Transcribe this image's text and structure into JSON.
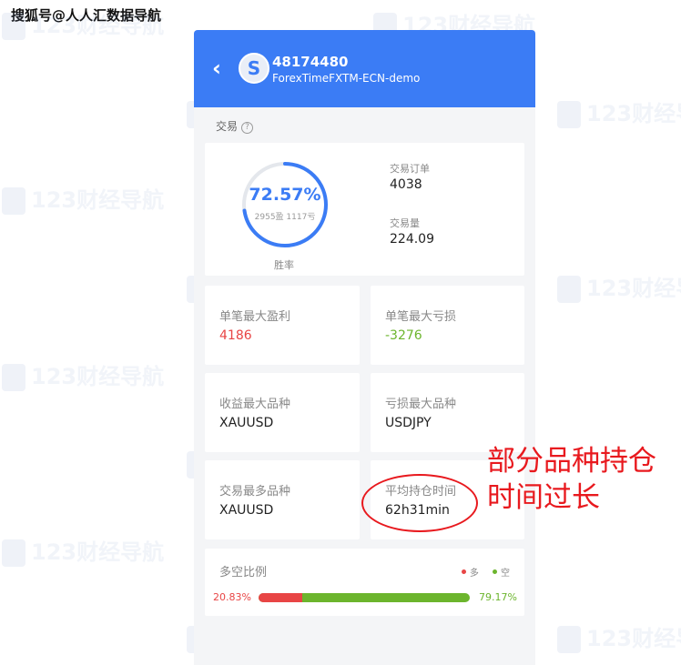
{
  "watermark": {
    "top_left": "搜狐号@人人汇数据导航",
    "background": "123财经导航"
  },
  "header": {
    "account_id": "48174480",
    "server": "ForexTimeFXTM-ECN-demo",
    "avatar_letter": "S",
    "back_glyph": "‹",
    "color": "#3b7cf5"
  },
  "section": {
    "title": "交易",
    "help_glyph": "?"
  },
  "win_rate": {
    "percent_text": "72.57%",
    "percent_value": 72.57,
    "sub": "2955盈 1117亏",
    "caption": "胜率",
    "color": "#3b7cf5",
    "track_color": "#e4e7ec"
  },
  "summary": {
    "orders_label": "交易订单",
    "orders_value": "4038",
    "volume_label": "交易量",
    "volume_value": "224.09"
  },
  "stats": {
    "max_profit_label": "单笔最大盈利",
    "max_profit_value": "4186",
    "max_loss_label": "单笔最大亏损",
    "max_loss_value": "-3276",
    "best_symbol_label": "收益最大品种",
    "best_symbol_value": "XAUUSD",
    "worst_symbol_label": "亏损最大品种",
    "worst_symbol_value": "USDJPY",
    "most_traded_label": "交易最多品种",
    "most_traded_value": "XAUUSD",
    "avg_hold_label": "平均持仓时间",
    "avg_hold_value": "62h31min",
    "profit_color": "#e84545",
    "loss_color": "#6cb52d"
  },
  "long_short": {
    "title": "多空比例",
    "legend_long": "多",
    "legend_short": "空",
    "long_text": "20.83%",
    "short_text": "79.17%",
    "long_value": 20.83,
    "short_value": 79.17,
    "long_color": "#e84545",
    "short_color": "#6cb52d"
  },
  "annotation": {
    "line1": "部分品种持仓",
    "line2": "时间过长",
    "color": "#e8191e"
  }
}
